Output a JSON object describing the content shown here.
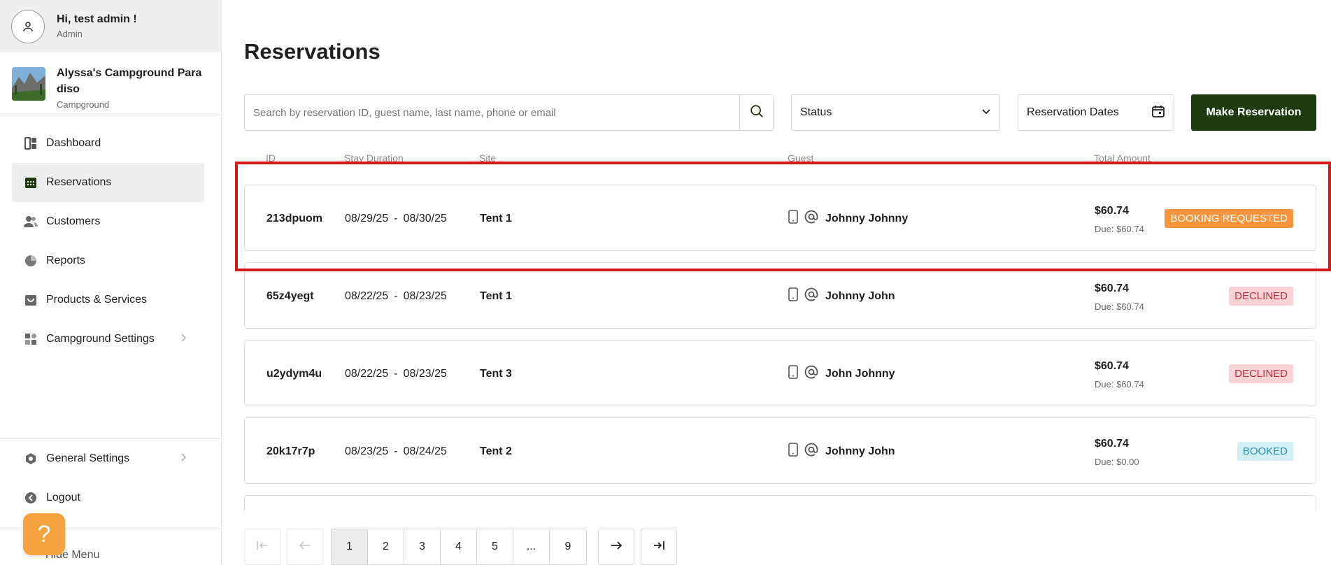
{
  "user": {
    "greeting": "Hi, test admin !",
    "role": "Admin"
  },
  "campground": {
    "name": "Alyssa's Campground Paradiso",
    "type": "Campground"
  },
  "nav": {
    "items": [
      {
        "label": "Dashboard",
        "icon": "dashboard-icon"
      },
      {
        "label": "Reservations",
        "icon": "calendar-icon"
      },
      {
        "label": "Customers",
        "icon": "users-icon"
      },
      {
        "label": "Reports",
        "icon": "pie-chart-icon"
      },
      {
        "label": "Products & Services",
        "icon": "shopping-bag-icon"
      },
      {
        "label": "Campground Settings",
        "icon": "grid-icon"
      }
    ],
    "bottom": [
      {
        "label": "General Settings",
        "icon": "hexagon-gear-icon"
      },
      {
        "label": "Logout",
        "icon": "logout-icon"
      }
    ],
    "hide_menu": "Hide Menu"
  },
  "page": {
    "title": "Reservations"
  },
  "filters": {
    "search_placeholder": "Search by reservation ID, guest name, last name, phone or email",
    "status_label": "Status",
    "dates_label": "Reservation Dates",
    "make_reservation": "Make Reservation"
  },
  "columns": {
    "id": "ID",
    "stay": "Stay Duration",
    "site": "Site",
    "guest": "Guest",
    "total": "Total Amount"
  },
  "reservations": [
    {
      "id": "213dpuom",
      "start": "08/29/25",
      "end": "08/30/25",
      "site": "Tent 1",
      "guest": "Johnny Johnny",
      "total": "$60.74",
      "due": "Due: $60.74",
      "status": "BOOKING REQUESTED"
    },
    {
      "id": "65z4yegt",
      "start": "08/22/25",
      "end": "08/23/25",
      "site": "Tent 1",
      "guest": "Johnny John",
      "total": "$60.74",
      "due": "Due: $60.74",
      "status": "DECLINED"
    },
    {
      "id": "u2ydym4u",
      "start": "08/22/25",
      "end": "08/23/25",
      "site": "Tent 3",
      "guest": "John Johnny",
      "total": "$60.74",
      "due": "Due: $60.74",
      "status": "DECLINED"
    },
    {
      "id": "20k17r7p",
      "start": "08/23/25",
      "end": "08/24/25",
      "site": "Tent 2",
      "guest": "Johnny John",
      "total": "$60.74",
      "due": "Due: $0.00",
      "status": "BOOKED"
    }
  ],
  "date_separator": "-",
  "pagination": {
    "pages": [
      "1",
      "2",
      "3",
      "4",
      "5",
      "...",
      "9"
    ],
    "current": "1"
  },
  "colors": {
    "accent": "#1f3a10",
    "requested": "#f7953f",
    "declined_bg": "#f8d3d6",
    "booked_bg": "#d4eef5",
    "help": "#f5a340",
    "highlight": "#d7191c"
  }
}
